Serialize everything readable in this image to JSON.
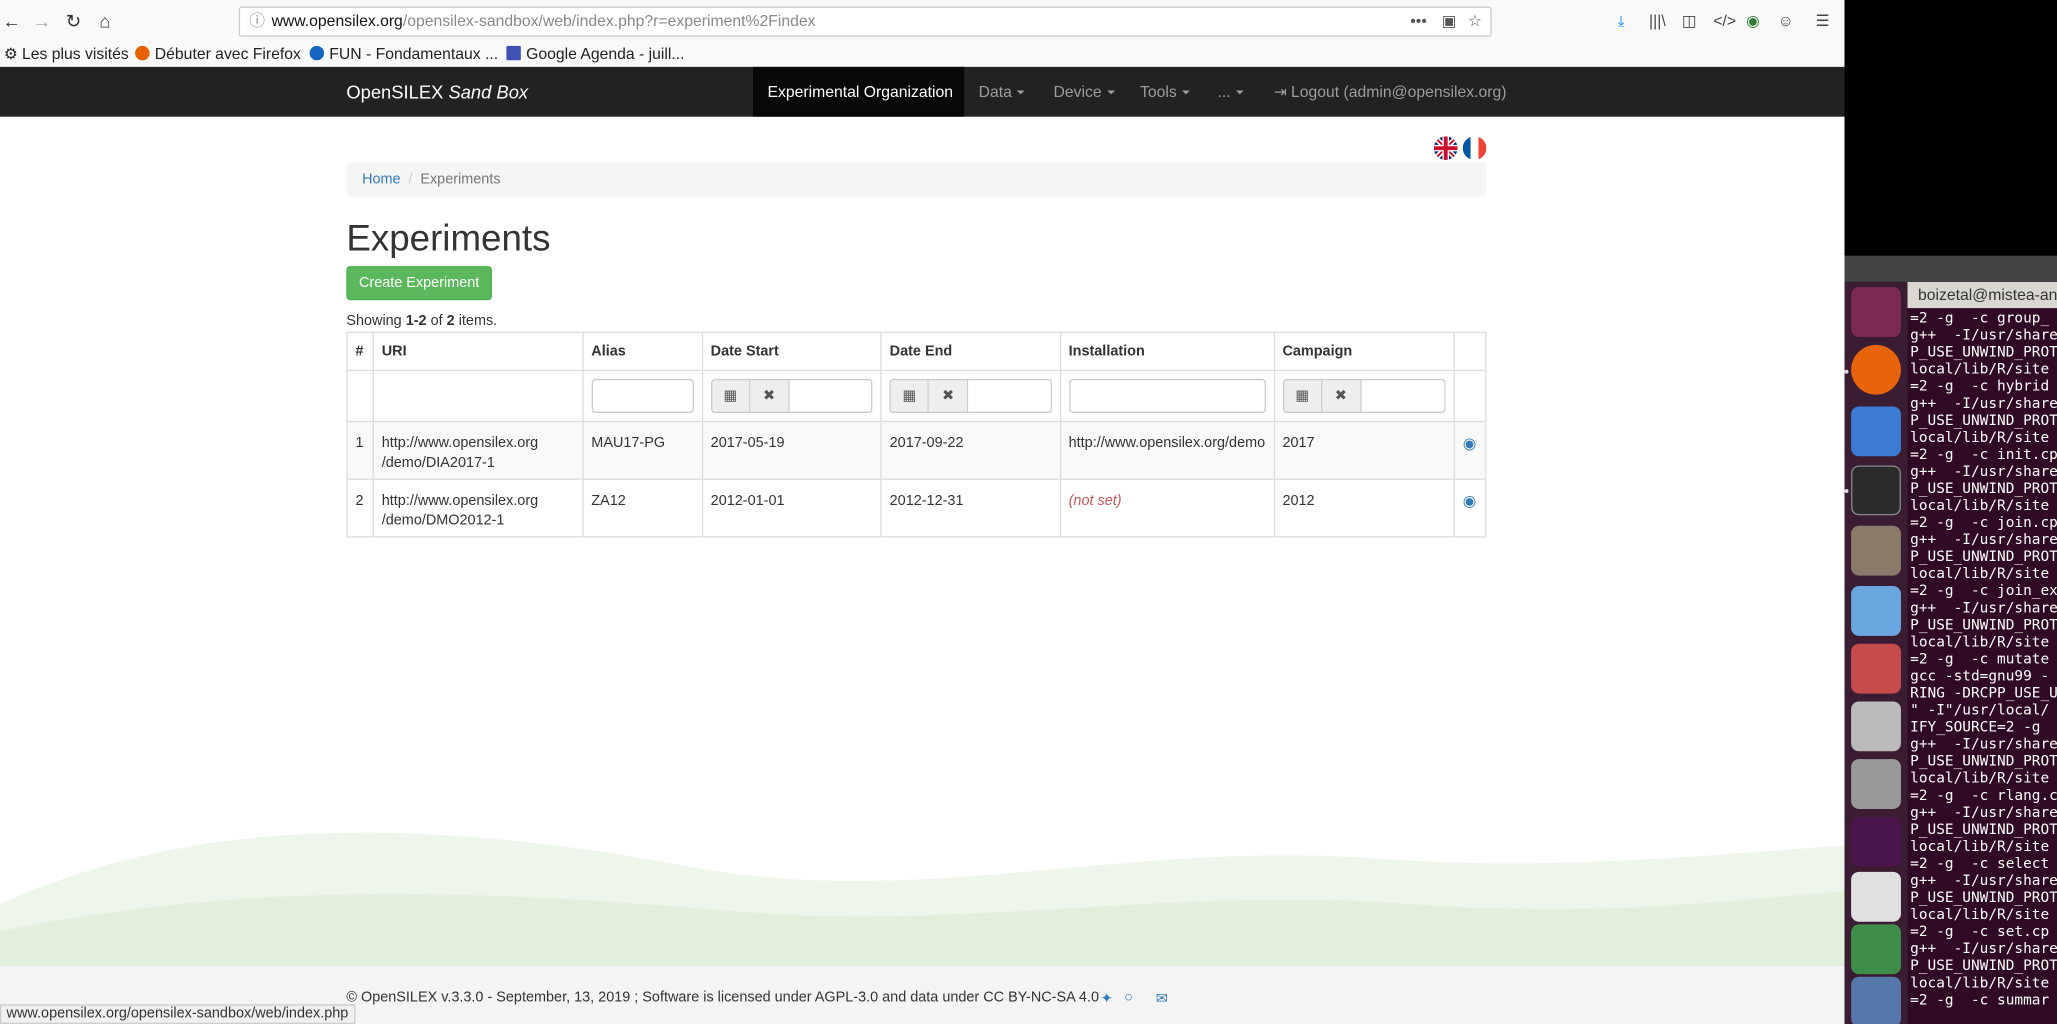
{
  "browser": {
    "url_host": "www.opensilex.org",
    "url_path": "/opensilex-sandbox/web/index.php?r=experiment%2Findex",
    "more_glyph": "•••",
    "bookmarks": [
      "Les plus visités",
      "Débuter avec Firefox",
      "FUN - Fondamentaux ...",
      "Google Agenda - juill..."
    ],
    "status_url": "www.opensilex.org/opensilex-sandbox/web/index.php"
  },
  "site": {
    "brand": "OpenSILEX",
    "brand_sub": "Sand Box",
    "nav": {
      "experimental_organization": "Experimental Organization",
      "data": "Data",
      "device": "Device",
      "tools": "Tools",
      "more": "...",
      "logout": "Logout (admin@opensilex.org)"
    }
  },
  "breadcrumb": {
    "home": "Home",
    "sep": "/",
    "current": "Experiments"
  },
  "page": {
    "title": "Experiments",
    "create_button": "Create Experiment",
    "summary_prefix": "Showing ",
    "summary_range": "1-2",
    "summary_of": " of ",
    "summary_total": "2",
    "summary_suffix": " items."
  },
  "table": {
    "headers": [
      "#",
      "URI",
      "Alias",
      "Date Start",
      "Date End",
      "Installation",
      "Campaign"
    ],
    "rows": [
      {
        "num": "1",
        "uri_line1": "http://www.opensilex.org",
        "uri_line2": "/demo/DIA2017-1",
        "alias": "MAU17-PG",
        "date_start": "2017-05-19",
        "date_end": "2017-09-22",
        "installation": "http://www.opensilex.org/demo",
        "campaign": "2017"
      },
      {
        "num": "2",
        "uri_line1": "http://www.opensilex.org",
        "uri_line2": "/demo/DMO2012-1",
        "alias": "ZA12",
        "date_start": "2012-01-01",
        "date_end": "2012-12-31",
        "installation": "(not set)",
        "campaign": "2012"
      }
    ]
  },
  "footer": {
    "text": "© OpenSILEX v.3.3.0 - September, 13, 2019 ; Software is licensed under AGPL-3.0 and data under CC BY-NC-SA 4.0"
  },
  "terminal": {
    "title": "boizetal@mistea-ani",
    "lines": [
      "=2 -g  -c group_",
      "g++  -I/usr/share",
      "P_USE_UNWIND_PROT",
      "local/lib/R/site",
      "=2 -g  -c hybrid",
      "g++  -I/usr/share",
      "P_USE_UNWIND_PROT",
      "local/lib/R/site",
      "=2 -g  -c init.cp",
      "g++  -I/usr/share",
      "P_USE_UNWIND_PROT",
      "local/lib/R/site",
      "=2 -g  -c join.cp",
      "g++  -I/usr/share",
      "P_USE_UNWIND_PROT",
      "local/lib/R/site",
      "=2 -g  -c join_ex",
      "g++  -I/usr/share",
      "P_USE_UNWIND_PROT",
      "local/lib/R/site",
      "=2 -g  -c mutate",
      "gcc -std=gnu99 -",
      "RING -DRCPP_USE_U",
      "\" -I\"/usr/local/",
      "IFY_SOURCE=2 -g",
      "g++  -I/usr/share",
      "P_USE_UNWIND_PROT",
      "local/lib/R/site",
      "=2 -g  -c rlang.c",
      "g++  -I/usr/share",
      "P_USE_UNWIND_PROT",
      "local/lib/R/site",
      "=2 -g  -c select",
      "g++  -I/usr/share",
      "P_USE_UNWIND_PROT",
      "local/lib/R/site",
      "=2 -g  -c set.cp",
      "g++  -I/usr/share",
      "P_USE_UNWIND_PROT",
      "local/lib/R/site",
      "=2 -g  -c summar"
    ]
  }
}
